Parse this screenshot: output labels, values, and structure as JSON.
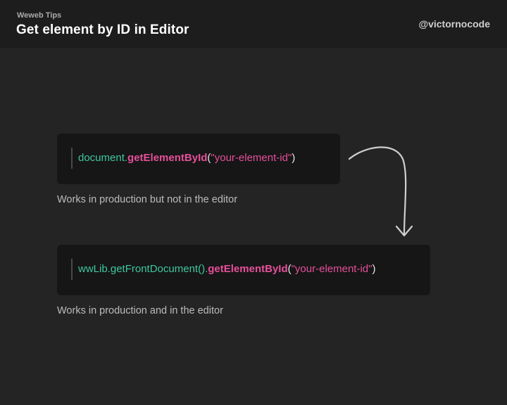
{
  "header": {
    "eyebrow": "Weweb Tips",
    "title": "Get element by ID in Editor",
    "handle": "@victornocode"
  },
  "snippets": [
    {
      "tokens": {
        "obj": "document",
        "dot": ".",
        "method": "getElementById",
        "open": "(",
        "arg": "\"your-element-id\"",
        "close": ")"
      },
      "caption": "Works in production but not in the editor"
    },
    {
      "tokens": {
        "obj": "wwLib.getFrontDocument()",
        "dot": ".",
        "method": "getElementById",
        "open": "(",
        "arg": "\"your-element-id\"",
        "close": ")"
      },
      "caption": "Works in production and in the editor"
    }
  ],
  "colors": {
    "background": "#242424",
    "header_background": "#1d1d1d",
    "code_background": "#161616",
    "object_green": "#3fc79f",
    "method_pink": "#e64f9a",
    "caption_gray": "#bcbcbc",
    "arrow": "#cfcfcf"
  },
  "icons": {
    "arrow": "curved-arrow-down-icon"
  }
}
